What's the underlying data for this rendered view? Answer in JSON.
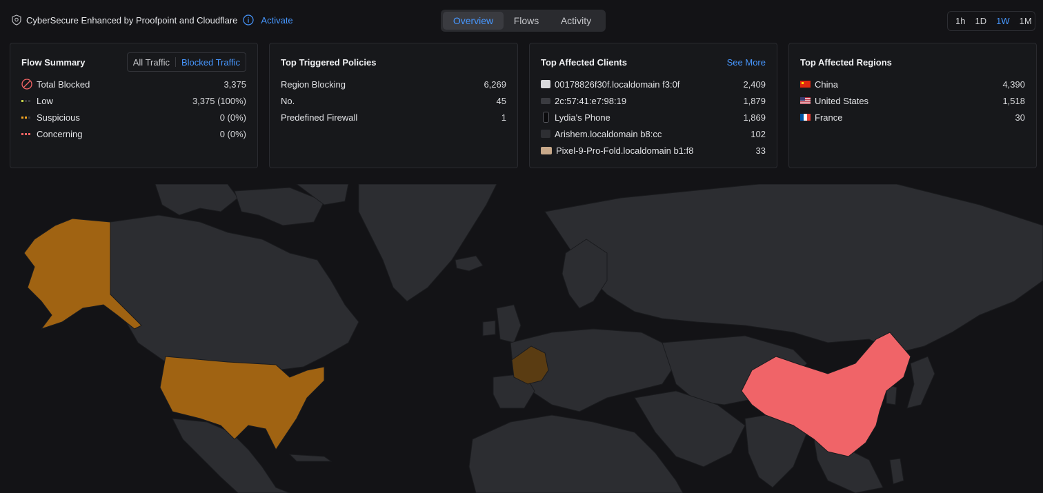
{
  "header": {
    "product_title": "CyberSecure Enhanced by Proofpoint and Cloudflare",
    "activate_label": "Activate",
    "tabs": [
      {
        "label": "Overview",
        "active": true
      },
      {
        "label": "Flows",
        "active": false
      },
      {
        "label": "Activity",
        "active": false
      }
    ],
    "time_ranges": [
      {
        "label": "1h",
        "active": false
      },
      {
        "label": "1D",
        "active": false
      },
      {
        "label": "1W",
        "active": true
      },
      {
        "label": "1M",
        "active": false
      }
    ]
  },
  "flow_summary": {
    "title": "Flow Summary",
    "toggle": {
      "all": "All Traffic",
      "blocked": "Blocked Traffic",
      "selected": "blocked"
    },
    "rows": [
      {
        "icon": "blocked-icon",
        "label": "Total Blocked",
        "value": "3,375"
      },
      {
        "icon": "low-severity-icon",
        "label": "Low",
        "value": "3,375 (100%)",
        "color": "#c8d64a"
      },
      {
        "icon": "suspicious-severity-icon",
        "label": "Suspicious",
        "value": "0 (0%)",
        "color": "#f5a623"
      },
      {
        "icon": "concerning-severity-icon",
        "label": "Concerning",
        "value": "0 (0%)",
        "color": "#f26464"
      }
    ]
  },
  "policies": {
    "title": "Top Triggered Policies",
    "rows": [
      {
        "label": "Region Blocking",
        "value": "6,269"
      },
      {
        "label": "No.",
        "value": "45"
      },
      {
        "label": "Predefined Firewall",
        "value": "1"
      }
    ]
  },
  "clients": {
    "title": "Top Affected Clients",
    "see_more": "See More",
    "rows": [
      {
        "icon": "device-icon",
        "label": "00178826f30f.localdomain f3:0f",
        "value": "2,409"
      },
      {
        "icon": "laptop-icon",
        "label": "2c:57:41:e7:98:19",
        "value": "1,879"
      },
      {
        "icon": "phone-icon",
        "label": "Lydia's Phone",
        "value": "1,869"
      },
      {
        "icon": "generic-device-icon",
        "label": "Arishem.localdomain b8:cc",
        "value": "102"
      },
      {
        "icon": "tablet-icon",
        "label": "Pixel-9-Pro-Fold.localdomain b1:f8",
        "value": "33"
      }
    ]
  },
  "regions": {
    "title": "Top Affected Regions",
    "rows": [
      {
        "icon": "china-flag-icon",
        "label": "China",
        "value": "4,390"
      },
      {
        "icon": "usa-flag-icon",
        "label": "United States",
        "value": "1,518"
      },
      {
        "icon": "france-flag-icon",
        "label": "France",
        "value": "30"
      }
    ]
  },
  "map": {
    "colors": {
      "background": "#131316",
      "land": "#2c2d31",
      "border": "#1a1b1e",
      "china": "#f06468",
      "united_states": "#a06312",
      "france": "#5a3c12"
    }
  }
}
